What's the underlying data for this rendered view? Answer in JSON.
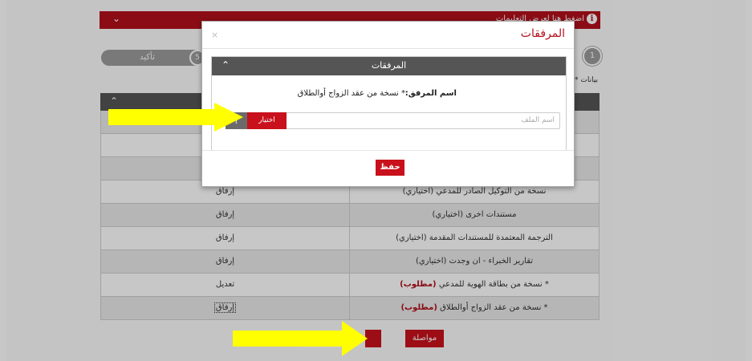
{
  "header": {
    "title": "اضغط هنا لعرض التعليمات",
    "info_icon": "i",
    "chevron_icon": "chevron-down-icon"
  },
  "steps": {
    "confirm_label": "تأكيد",
    "confirm_number": "5",
    "first_number": "1"
  },
  "note": "* بيانات",
  "table": {
    "rows": [
      {
        "doc": "",
        "action": "",
        "required": ""
      },
      {
        "doc": "",
        "action": "",
        "required": ""
      },
      {
        "doc": "",
        "action": "",
        "required": ""
      },
      {
        "doc": "نسخة من التوكيل الصادر للمدعي (اختياري)",
        "action": "إرفاق",
        "required": ""
      },
      {
        "doc": "مستندات اخرى (اختياري)",
        "action": "إرفاق",
        "required": ""
      },
      {
        "doc": "الترجمة المعتمدة للمستندات المقدمة (اختياري)",
        "action": "إرفاق",
        "required": ""
      },
      {
        "doc": "تقارير الخبراء - ان وجدت (اختياري)",
        "action": "إرفاق",
        "required": ""
      },
      {
        "doc": "* نسخة من بطاقة الهوية للمدعي",
        "action": "تعديل",
        "required": "(مطلوب)"
      },
      {
        "doc": "* نسخة من عقد الزواج أوالطلاق",
        "action": "إرفاق",
        "required": "(مطلوب)"
      }
    ]
  },
  "buttons": {
    "continue": "مواصلة"
  },
  "dialog": {
    "title": "المرفقات",
    "close": "×",
    "section_title": "المرفقات",
    "attachment_label": "اسم المرفق:",
    "attachment_value": "* نسخة من عقد الزواج أوالطلاق",
    "file_placeholder": "اسم الملف",
    "choose_button": "اختيار",
    "grey_button": "إ",
    "save_button": "حفظ"
  },
  "colors": {
    "brand_red": "#b2101c",
    "button_red": "#c8111c",
    "header_grey": "#555555",
    "arrow_yellow": "#ffff00"
  }
}
